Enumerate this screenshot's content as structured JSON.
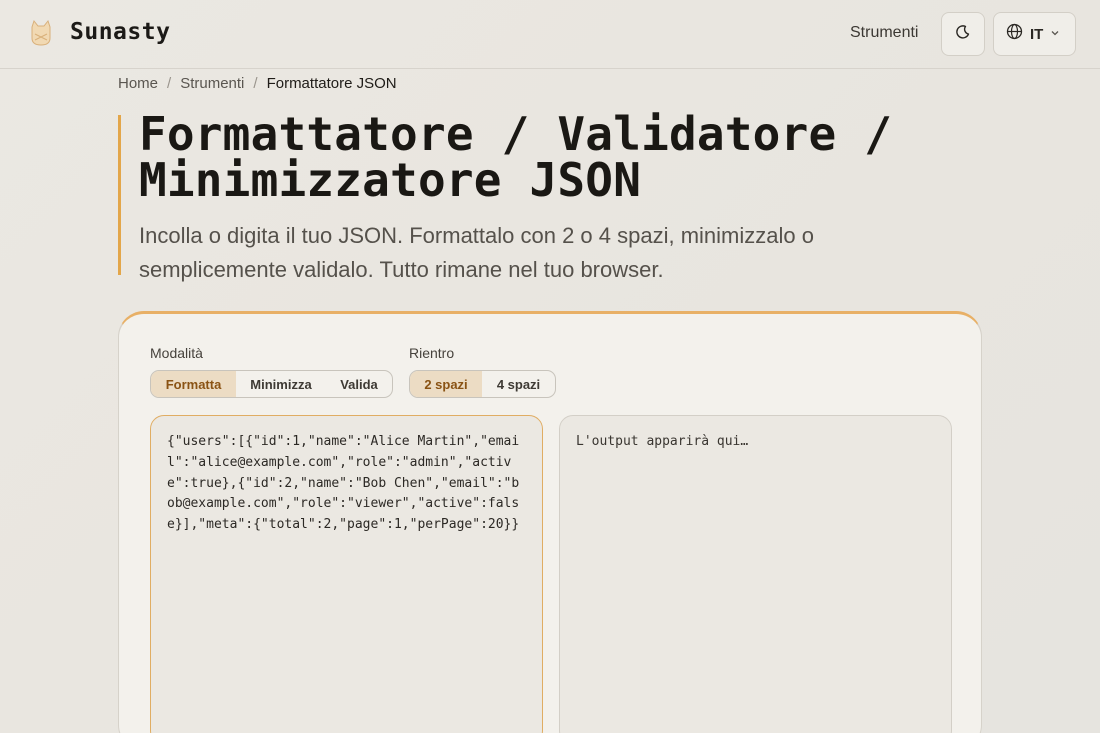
{
  "header": {
    "brand": "Sunasty",
    "nav_tools": "Strumenti",
    "lang": "IT"
  },
  "breadcrumb": {
    "home": "Home",
    "tools": "Strumenti",
    "current": "Formattatore JSON"
  },
  "hero": {
    "title_line1": "Formattatore / Validatore /",
    "title_line2": "Minimizzatore JSON",
    "description": "Incolla o digita il tuo JSON. Formattalo con 2 o 4 spazi, minimizzalo o semplicemente validalo. Tutto rimane nel tuo browser."
  },
  "mode": {
    "label": "Modalità",
    "options": [
      "Formatta",
      "Minimizza",
      "Valida"
    ],
    "selected": "Formatta"
  },
  "indent": {
    "label": "Rientro",
    "options": [
      "2 spazi",
      "4 spazi"
    ],
    "selected": "2 spazi"
  },
  "editor": {
    "input_value": "{\"users\":[{\"id\":1,\"name\":\"Alice Martin\",\"email\":\"alice@example.com\",\"role\":\"admin\",\"active\":true},{\"id\":2,\"name\":\"Bob Chen\",\"email\":\"bob@example.com\",\"role\":\"viewer\",\"active\":false}],\"meta\":{\"total\":2,\"page\":1,\"perPage\":20}}",
    "output_placeholder": "L'output apparirà qui…"
  },
  "colors": {
    "accent": "#e3a64a",
    "active_segment_bg": "#ecdcc4",
    "active_segment_text": "#8a5314",
    "background": "#e9e7e2"
  },
  "icons": {
    "logo": "cat-logo-icon",
    "theme": "moon-icon",
    "language": "globe-icon",
    "dropdown": "chevron-down-icon"
  }
}
